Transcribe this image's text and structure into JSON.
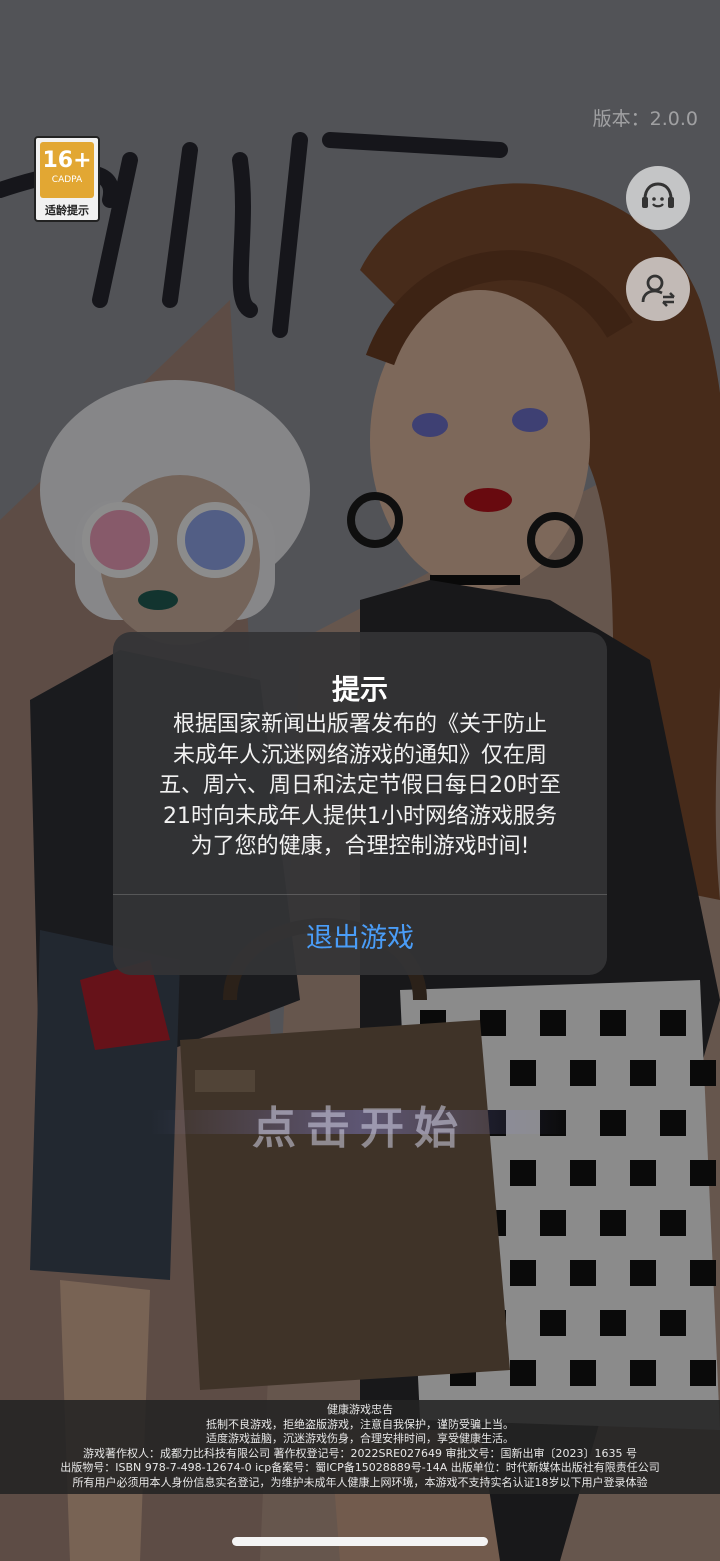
{
  "version": "版本：2.0.0",
  "age_badge": {
    "rating": "16+",
    "org": "CADPA",
    "label": "适龄提示"
  },
  "icons": {
    "support": "headset-support-icon",
    "account": "switch-account-icon"
  },
  "start_label": "点击开始",
  "dialog": {
    "title": "提示",
    "message_lines": [
      "根据国家新闻出版署发布的《关于防止",
      "未成年人沉迷网络游戏的通知》仅在周",
      "五、周六、周日和法定节假日每日20时至",
      "21时向未成年人提供1小时网络游戏服务",
      "为了您的健康，合理控制游戏时间!"
    ],
    "button": "退出游戏",
    "button_color": "#4a9df8"
  },
  "footer": {
    "lines": [
      "健康游戏忠告",
      "抵制不良游戏，拒绝盗版游戏，注意自我保护，谨防受骗上当。",
      "适度游戏益脑，沉迷游戏伤身，合理安排时间，享受健康生活。",
      "游戏著作权人：成都力比科技有限公司 著作权登记号：2022SRE027649 审批文号：国新出审〔2023〕1635 号",
      "出版物号：ISBN 978-7-498-12674-0 icp备案号：蜀ICP备15028889号-14A 出版单位：时代新媒体出版社有限责任公司",
      "所有用户必须用本人身份信息实名登记，为维护未成年人健康上网环境，本游戏不支持实名认证18岁以下用户登录体验"
    ]
  }
}
